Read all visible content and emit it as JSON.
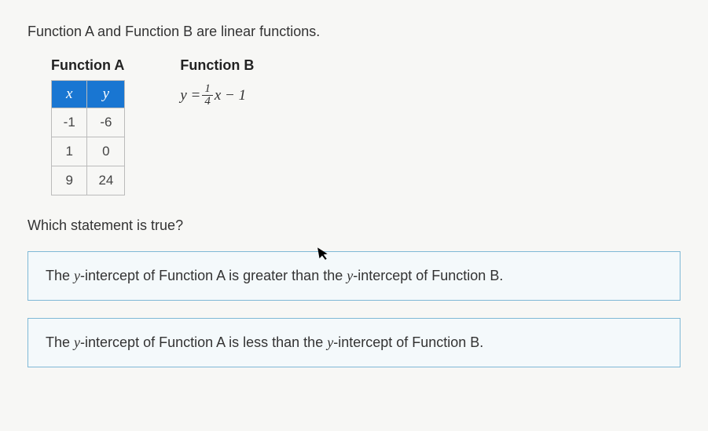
{
  "intro": "Function A and Function B are linear functions.",
  "functionA": {
    "title": "Function A",
    "headers": {
      "x": "x",
      "y": "y"
    },
    "rows": [
      {
        "x": "-1",
        "y": "-6"
      },
      {
        "x": "1",
        "y": "0"
      },
      {
        "x": "9",
        "y": "24"
      }
    ]
  },
  "functionB": {
    "title": "Function B",
    "eq_left": "y = ",
    "eq_num": "1",
    "eq_den": "4",
    "eq_right": "x − 1"
  },
  "question": "Which statement is true?",
  "options": {
    "a": {
      "pre": "The ",
      "var": "y",
      "mid1": "-intercept of Function A is greater than the ",
      "var2": "y",
      "post": "-intercept of Function B."
    },
    "b": {
      "pre": "The ",
      "var": "y",
      "mid1": "-intercept of Function A is less than the ",
      "var2": "y",
      "post": "-intercept of Function B."
    }
  }
}
